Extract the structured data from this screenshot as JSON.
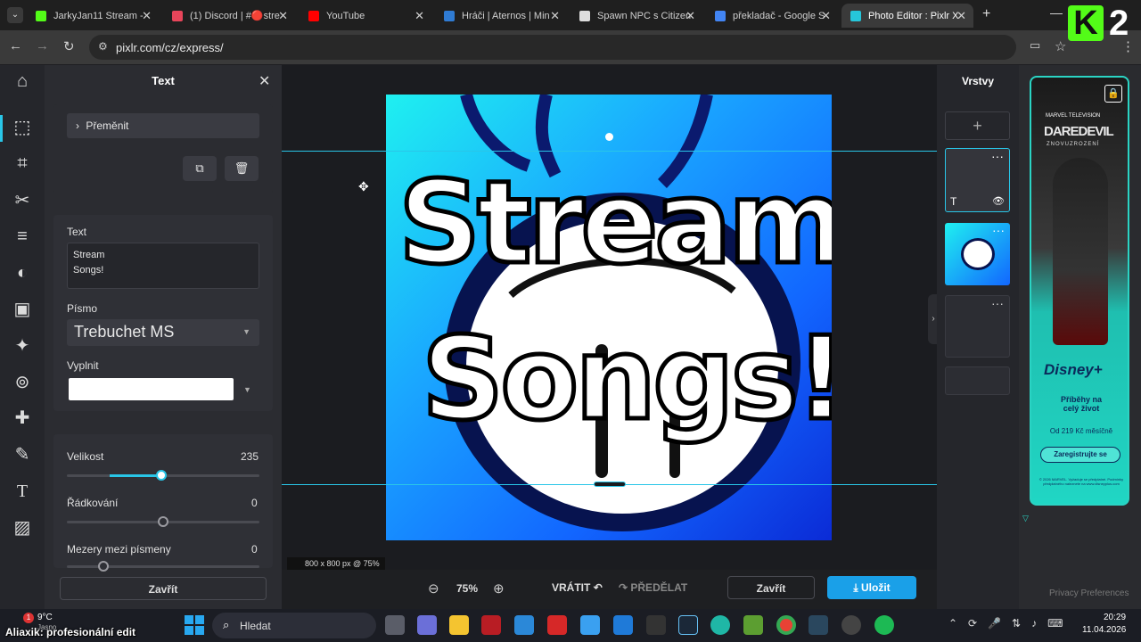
{
  "browser": {
    "tabs": [
      {
        "label": "JarkyJan11 Stream - ",
        "color": "#53fc18"
      },
      {
        "label": "(1) Discord | #🔴stre",
        "color": "#e8455a"
      },
      {
        "label": "YouTube",
        "color": "#ff0000"
      },
      {
        "label": "Hráči | Aternos | Min",
        "color": "#2f7bd3"
      },
      {
        "label": "Spawn NPC s Citizen",
        "color": "#dddddd"
      },
      {
        "label": "překladač - Google S",
        "color": "#4285f4"
      },
      {
        "label": "Photo Editor : Pixlr X",
        "color": "#26c6da"
      }
    ],
    "new_tab": "+",
    "url": "pixlr.com/cz/express/",
    "overlay_logo": "K",
    "overlay_number": "2"
  },
  "sidebar": {
    "tools": [
      "select-icon",
      "crop-icon",
      "cut-icon",
      "adjust-icon",
      "filter-icon",
      "effect-icon",
      "ai-icon",
      "liquify-icon",
      "heal-icon",
      "draw-icon",
      "text-icon",
      "pattern-icon"
    ]
  },
  "text_panel": {
    "title": "Text",
    "transform_label": "Přeměnit",
    "text_label": "Text",
    "text_value_line1": "Stream",
    "text_value_line2": "Songs!",
    "font_label": "Písmo",
    "font_value": "Trebuchet MS",
    "fill_label": "Vyplnit",
    "fill_color": "#ffffff",
    "size_label": "Velikost",
    "size_value": "235",
    "size_fraction": 0.49,
    "line_spacing_label": "Řádkování",
    "line_spacing_value": "0",
    "line_spacing_fraction": 0.5,
    "letter_spacing_label": "Mezery mezi písmeny",
    "letter_spacing_value": "0",
    "letter_spacing_fraction": 0.19,
    "close_label": "Zavřít"
  },
  "canvas": {
    "line1": "Stream",
    "line2": "Songs!",
    "info": "800 x 800 px @ 75%"
  },
  "bottom": {
    "zoom": "75%",
    "undo": "VRÁTIT",
    "redo": "PŘEDĚLAT",
    "close": "Zavřít",
    "save": "Uložit"
  },
  "layers": {
    "title": "Vrstvy",
    "add": "+"
  },
  "ad": {
    "brand_top": "MARVEL TELEVISION",
    "title": "DAREDEVIL",
    "subtitle": "ZNOVUZROZENÍ",
    "disney": "Disney+",
    "tagline": "Příběhy na celý život",
    "price": "Od 219 Kč měsíčně",
    "cta": "Zaregistrujte se",
    "fine_print": "© 2026 MARVEL. Vyžaduje se předplatné. Podmínky předplatného naleznete na www.disneyplus.com",
    "privacy": "Privacy Preferences"
  },
  "taskbar": {
    "weather_temp": "9°C",
    "weather_desc": "Jasno",
    "overlay_text": "Aliaxik: profesionální edit",
    "search": "Hledat",
    "time": "20:29",
    "date": "11.04.2026",
    "badge": "1"
  }
}
